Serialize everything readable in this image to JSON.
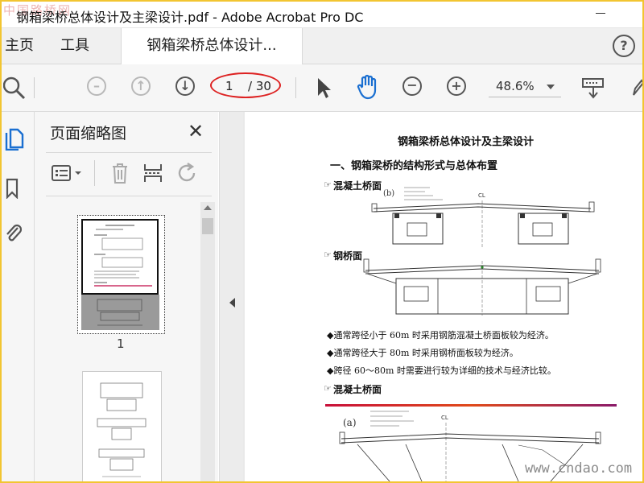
{
  "window": {
    "title": "钢箱梁桥总体设计及主梁设计.pdf - Adobe Acrobat Pro DC",
    "watermark": "中国路桥网"
  },
  "tabs": [
    {
      "label": "主页"
    },
    {
      "label": "工具"
    },
    {
      "label": "钢箱梁桥总体设计..."
    }
  ],
  "toolbar": {
    "page_current": "1",
    "page_total": "/ 30",
    "zoom": "48.6%"
  },
  "sidebar": {
    "title": "页面缩略图",
    "page_label": "1"
  },
  "document": {
    "title": "钢箱梁桥总体设计及主梁设计",
    "section1": "一、钢箱梁桥的结构形式与总体布置",
    "label_concrete": "混凝土桥面",
    "label_steel": "钢桥面",
    "bullet1": "◆通常跨径小于 60m 时采用钢筋混凝土桥面板较为经济。",
    "bullet2": "◆通常跨径大于 80m 时采用钢桥面板较为经济。",
    "bullet3": "◆跨径 60～80m 时需要进行较为详细的技术与经济比较。",
    "label_concrete2": "混凝土桥面",
    "fig_b": "(b)",
    "fig_a": "(a)",
    "cl": "CL"
  },
  "footer_watermark": "www.cndao.com",
  "colors": {
    "frame": "#f2c531",
    "annotation": "#d22222",
    "accent_blue": "#1a6fd1"
  }
}
